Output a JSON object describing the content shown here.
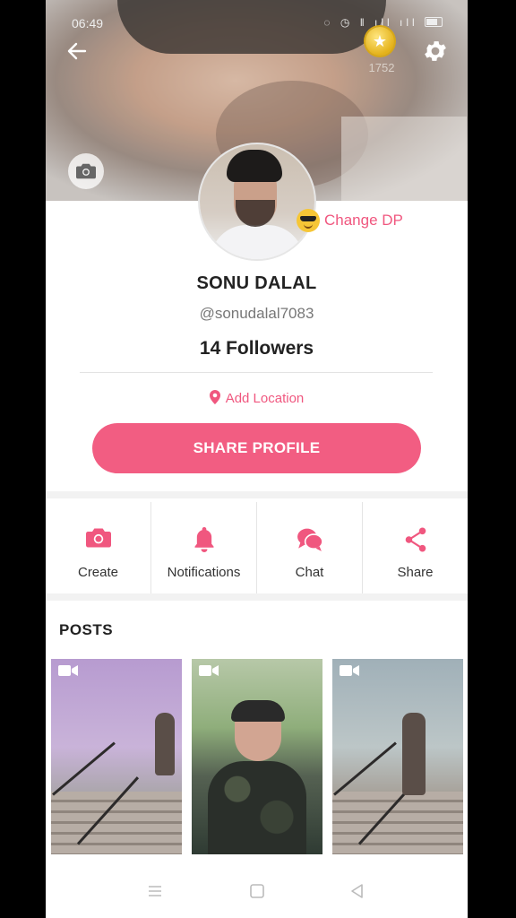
{
  "status_bar": {
    "time": "06:49",
    "icons": "◌ ◷ ‖ ıll ıll"
  },
  "header": {
    "coins": "1752"
  },
  "profile": {
    "change_dp_label": "Change DP",
    "name": "SONU DALAL",
    "username": "@sonudalal7083",
    "followers": "14 Followers",
    "location_label": "Add Location",
    "share_button": "SHARE PROFILE"
  },
  "actions": [
    {
      "label": "Create",
      "icon": "camera-icon"
    },
    {
      "label": "Notifications",
      "icon": "bell-icon"
    },
    {
      "label": "Chat",
      "icon": "chat-bubbles-icon"
    },
    {
      "label": "Share",
      "icon": "share-icon"
    }
  ],
  "posts": {
    "title": "POSTS"
  },
  "colors": {
    "accent": "#f25d82",
    "accent_text": "#f0577f"
  }
}
